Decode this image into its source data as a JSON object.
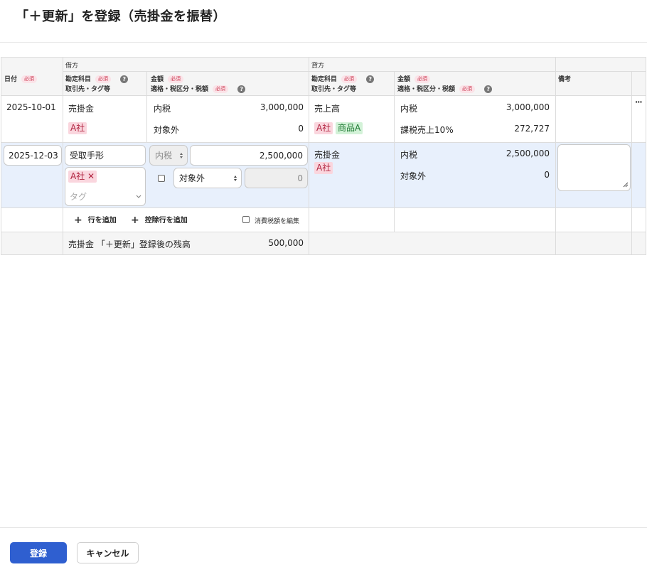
{
  "page": {
    "title": "「＋更新」を登録（売掛金を振替）"
  },
  "table": {
    "group_headers": {
      "debit": "借方",
      "credit": "貸方"
    },
    "columns": {
      "date": "日付",
      "required": "必須",
      "help": "?",
      "account": "勘定科目",
      "partner_tag": "取引先・タグ等",
      "amount": "金額",
      "debit_tax_line": "適格・税区分・税額",
      "credit_tax_line": "適格・税区分・税額",
      "memo": "備考"
    },
    "row1": {
      "date": "2025-10-01",
      "debit": {
        "account": "売掛金",
        "tag": "A社",
        "tax_type": "内税",
        "amount": "3,000,000",
        "tax_class": "対象外",
        "tax_amount": "0"
      },
      "credit": {
        "account": "売上高",
        "tag1": "A社",
        "tag2": "商品A",
        "tax_type": "内税",
        "amount": "3,000,000",
        "tax_class": "課税売上10%",
        "tax_amount": "272,727"
      },
      "menu": "···"
    },
    "row2": {
      "date": "2025-12-03",
      "debit": {
        "account": "受取手形",
        "tag": "A社",
        "tag_remove": "✕",
        "tag_placeholder": "タグ",
        "tax_type": "内税",
        "amount": "2,500,000",
        "tax_class": "対象外",
        "tax_amount": "0"
      },
      "credit": {
        "account": "売掛金",
        "tag": "A社",
        "tax_type": "内税",
        "amount": "2,500,000",
        "tax_class": "対象外",
        "tax_amount": "0"
      },
      "memo": ""
    },
    "actions": {
      "add_row": "行を追加",
      "add_deduction_row": "控除行を追加",
      "edit_tax": "消費税額を編集"
    },
    "balance": {
      "label": "売掛金 「＋更新」登録後の残高",
      "value": "500,000"
    }
  },
  "footer": {
    "submit": "登録",
    "cancel": "キャンセル"
  },
  "colors": {
    "primary": "#2f5fd0",
    "row_highlight": "#e8f0fc",
    "header_bg": "#f5f5f5",
    "required_bg": "#fbe3e8",
    "tag_pink": "#fad6de",
    "tag_green": "#d3f2d8"
  }
}
